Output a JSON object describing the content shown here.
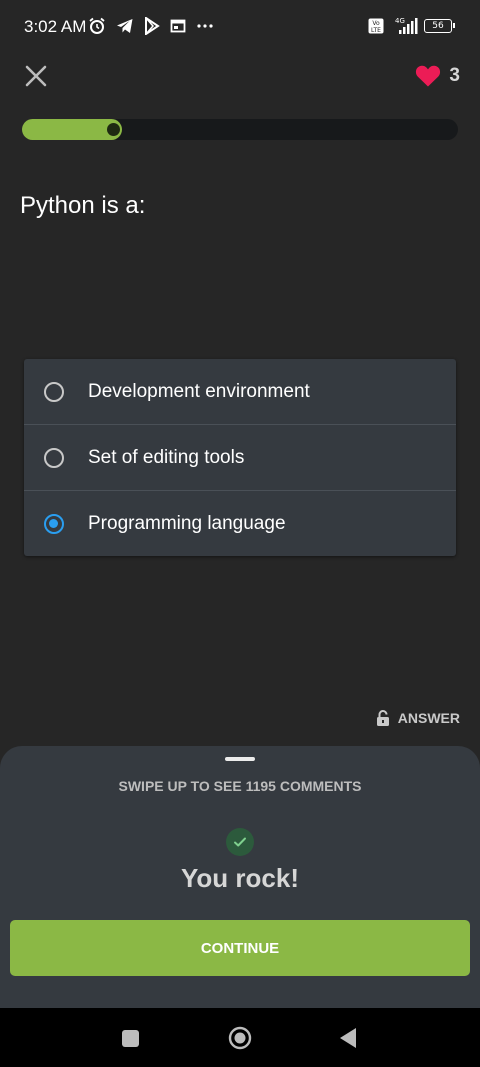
{
  "status_bar": {
    "time": "3:02 AM",
    "network": "4G",
    "battery": "56",
    "icons": [
      "alarm-icon",
      "telegram-icon",
      "play-store-icon",
      "window-icon",
      "more-dots-icon",
      "volte-icon",
      "signal-icon",
      "battery-icon"
    ]
  },
  "header": {
    "lives": "3"
  },
  "progress": {
    "fraction": 0.23
  },
  "question": {
    "text": "Python is a:"
  },
  "options": [
    {
      "label": "Development environment",
      "selected": false
    },
    {
      "label": "Set of editing tools",
      "selected": false
    },
    {
      "label": "Programming language",
      "selected": true
    }
  ],
  "answer_link": {
    "label": "ANSWER"
  },
  "sheet": {
    "swipe_text": "SWIPE UP TO SEE 1195 COMMENTS",
    "result_text": "You rock!",
    "continue_label": "CONTINUE"
  },
  "colors": {
    "accent_green": "#8bb845",
    "heart": "#ec1c56",
    "radio_selected": "#2a9ef0",
    "background": "#262626",
    "card": "#353a40"
  }
}
